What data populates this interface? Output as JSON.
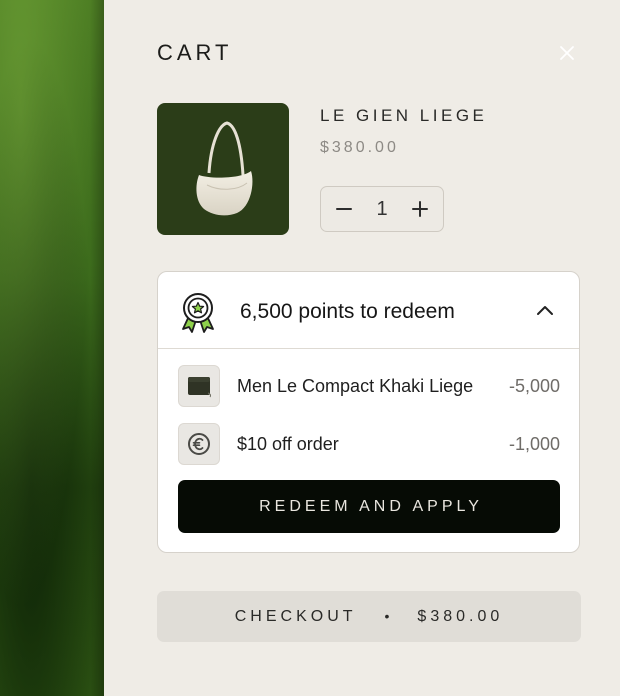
{
  "cart": {
    "title": "CART",
    "close_icon": "close-icon"
  },
  "product": {
    "name": "LE GIEN LIEGE",
    "price": "$380.00",
    "quantity": "1",
    "image": "white-shoulder-bag"
  },
  "rewards": {
    "points_text": "6,500 points to redeem",
    "award_icon": "award-ribbon-icon",
    "chevron_icon": "chevron-up-icon",
    "items": [
      {
        "label": "Men Le Compact Khaki Liege",
        "points": "-5,000",
        "icon": "wallet-thumbnail"
      },
      {
        "label": "$10 off order",
        "points": "-1,000",
        "icon": "euro-coin-icon"
      }
    ],
    "redeem_label": "REDEEM AND APPLY"
  },
  "checkout": {
    "label": "CHECKOUT",
    "separator": "•",
    "total": "$380.00"
  },
  "colors": {
    "drawer_bg": "#efece6",
    "redeem_bg": "#060b05",
    "checkout_bg": "#e0ddd7",
    "award_accent": "#8ed14a",
    "product_bg": "#2b3d18"
  }
}
